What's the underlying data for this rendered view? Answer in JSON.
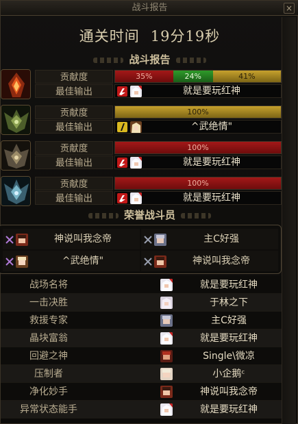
{
  "window": {
    "title": "战斗报告",
    "close_glyph": "×"
  },
  "clear_time": {
    "label": "通关时间",
    "value": "19分19秒"
  },
  "battle_report": {
    "heading": "战斗报告",
    "contribution_label": "贡献度",
    "best_output_label": "最佳输出",
    "players": [
      {
        "class_icon": "flame-warrior-icon",
        "segments": [
          {
            "color": "red",
            "percent": 35,
            "text": "35%"
          },
          {
            "color": "green",
            "percent": 24,
            "text": "24%"
          },
          {
            "color": "gold",
            "percent": 41,
            "text": "41%"
          }
        ],
        "best_skill": "red",
        "best_name": "就是要玩红神"
      },
      {
        "class_icon": "green-armor-icon",
        "segments": [
          {
            "color": "gold",
            "percent": 100,
            "text": "100%"
          }
        ],
        "best_skill": "yellow",
        "best_name": "^武绝情\""
      },
      {
        "class_icon": "dark-armor-icon",
        "segments": [
          {
            "color": "red",
            "percent": 100,
            "text": "100%"
          }
        ],
        "best_skill": "red",
        "best_name": "就是要玩红神"
      },
      {
        "class_icon": "blue-armor-icon",
        "segments": [
          {
            "color": "red",
            "percent": 100,
            "text": "100%"
          }
        ],
        "best_skill": "red",
        "best_name": "就是要玩红神"
      }
    ]
  },
  "honor": {
    "heading": "荣誉战斗员",
    "members": [
      {
        "name": "神说叫我念帝"
      },
      {
        "name": "主C好强"
      },
      {
        "name": "^武绝情\""
      },
      {
        "name": "神说叫我念帝"
      }
    ]
  },
  "awards": [
    {
      "title": "战场名将",
      "name": "就是要玩红神"
    },
    {
      "title": "一击决胜",
      "name": "于林之下"
    },
    {
      "title": "救援专家",
      "name": "主C好强"
    },
    {
      "title": "晶块富翁",
      "name": "就是要玩红神"
    },
    {
      "title": "回避之神",
      "name": "Single\\微凉"
    },
    {
      "title": "压制者",
      "name": "小企鹅ᶜ"
    },
    {
      "title": "净化妙手",
      "name": "神说叫我念帝"
    },
    {
      "title": "异常状态能手",
      "name": "就是要玩红神"
    }
  ]
}
